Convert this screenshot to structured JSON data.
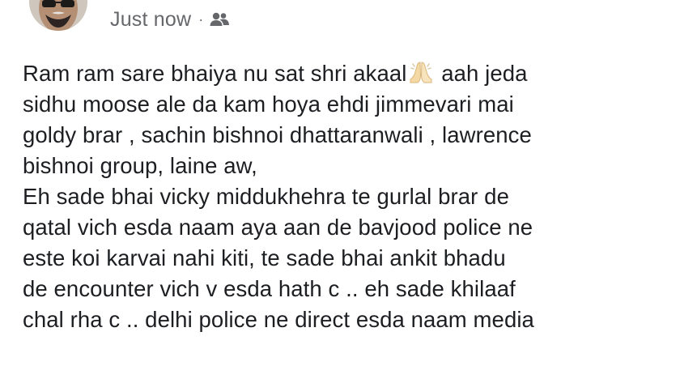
{
  "post": {
    "timestamp": "Just now",
    "separator": "·",
    "audience_icon": "friends-icon",
    "body": {
      "line1_before_emoji": "Ram ram sare bhaiya nu sat shri akaal",
      "emoji": "folded-hands-icon",
      "line1_after_emoji": " aah jeda",
      "line2": "sidhu moose ale da kam hoya ehdi jimmevari mai",
      "line3": "goldy brar , sachin bishnoi dhattaranwali , lawrence",
      "line4": "bishnoi group,  laine aw,",
      "line5": "Eh sade bhai vicky middukhehra te gurlal brar de",
      "line6": "qatal vich esda naam aya aan de bavjood police ne",
      "line7": "este koi karvai nahi kiti, te sade bhai ankit bhadu",
      "line8": "de encounter vich v esda hath c .. eh sade khilaaf",
      "line9": "chal rha c .. delhi police ne direct esda naam media"
    }
  }
}
